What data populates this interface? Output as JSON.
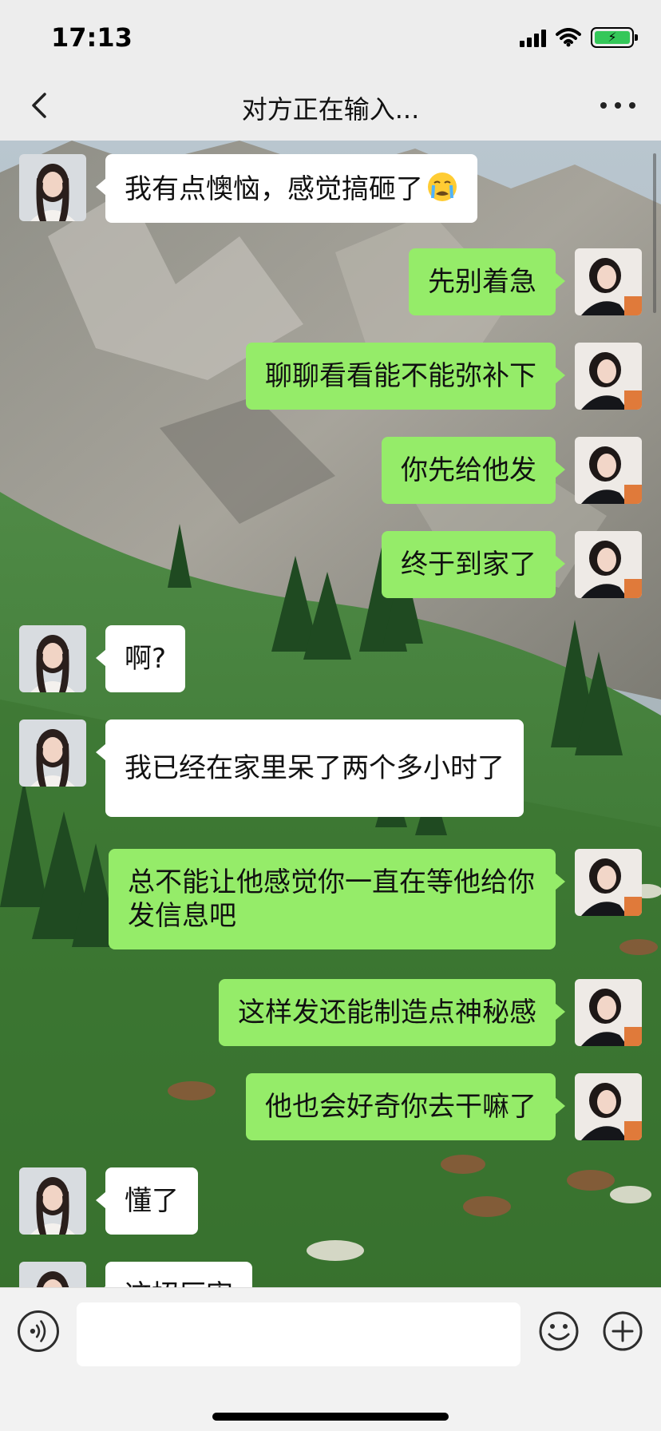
{
  "status_bar": {
    "time": "17:13"
  },
  "nav": {
    "title": "对方正在输入..."
  },
  "messages": [
    {
      "side": "in",
      "text": "我有点懊恼，感觉搞砸了"
    },
    {
      "side": "out",
      "text": "先别着急"
    },
    {
      "side": "out",
      "text": "聊聊看看能不能弥补下"
    },
    {
      "side": "out",
      "text": "你先给他发"
    },
    {
      "side": "out",
      "text": "终于到家了"
    },
    {
      "side": "in",
      "text": "啊?"
    },
    {
      "side": "in",
      "text": "我已经在家里呆了两个多小时了"
    },
    {
      "side": "out",
      "text": "总不能让他感觉你一直在等他给你发信息吧"
    },
    {
      "side": "out",
      "text": "这样发还能制造点神秘感"
    },
    {
      "side": "out",
      "text": "他也会好奇你去干嘛了"
    },
    {
      "side": "in",
      "text": "懂了"
    },
    {
      "side": "in",
      "text": "这招厉害"
    }
  ],
  "input": {
    "value": ""
  },
  "icons": {
    "back": "chevron-left-icon",
    "more": "more-dots-icon",
    "voice": "voice-icon",
    "emoji": "emoji-icon",
    "plus": "plus-icon",
    "message_emoji": "crying-face-emoji"
  },
  "colors": {
    "outgoing_bubble": "#95ec69",
    "incoming_bubble": "#ffffff",
    "bar_background": "#ededed"
  }
}
